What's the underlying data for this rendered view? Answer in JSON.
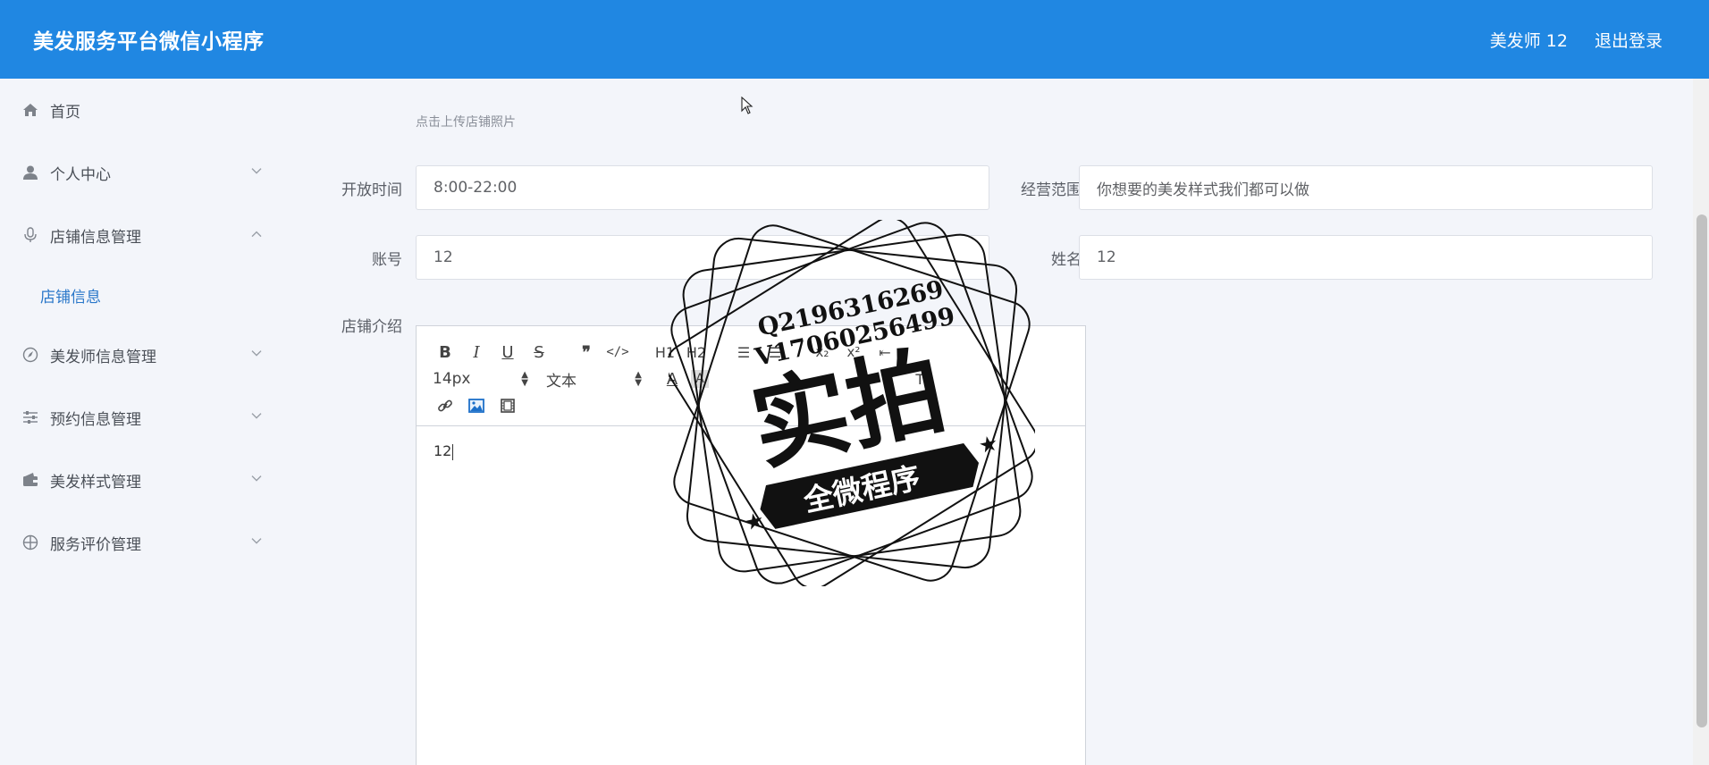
{
  "header": {
    "title": "美发服务平台微信小程序",
    "user": "美发师 12",
    "logout": "退出登录"
  },
  "sidebar": {
    "items": [
      {
        "label": "首页",
        "icon": "home-icon"
      },
      {
        "label": "个人中心",
        "icon": "user-icon"
      },
      {
        "label": "店铺信息管理",
        "icon": "microphone-icon",
        "expanded": true,
        "children": [
          {
            "label": "店铺信息"
          }
        ]
      },
      {
        "label": "美发师信息管理",
        "icon": "compass-icon"
      },
      {
        "label": "预约信息管理",
        "icon": "sliders-icon"
      },
      {
        "label": "美发样式管理",
        "icon": "wallet-icon"
      },
      {
        "label": "服务评价管理",
        "icon": "crosshair-icon"
      }
    ]
  },
  "form": {
    "upload_hint": "点击上传店铺照片",
    "open_time": {
      "label": "开放时间",
      "value": "8:00-22:00"
    },
    "scope": {
      "label": "经营范围",
      "value": "你想要的美发样式我们都可以做"
    },
    "account": {
      "label": "账号",
      "value": "12"
    },
    "name": {
      "label": "姓名",
      "value": "12"
    },
    "intro": {
      "label": "店铺介绍",
      "content": "12"
    }
  },
  "editor_toolbar": {
    "font_size": "14px",
    "header_select": "文本",
    "headings": [
      "H1",
      "H2"
    ]
  },
  "watermark": {
    "line1": "Q2196316269",
    "line2": "V17060256499",
    "main": "实拍",
    "banner": "全微程序"
  },
  "colors": {
    "header_bg": "#2087e2",
    "active_submenu": "#2a77c9",
    "page_bg": "#f3f5fa"
  }
}
